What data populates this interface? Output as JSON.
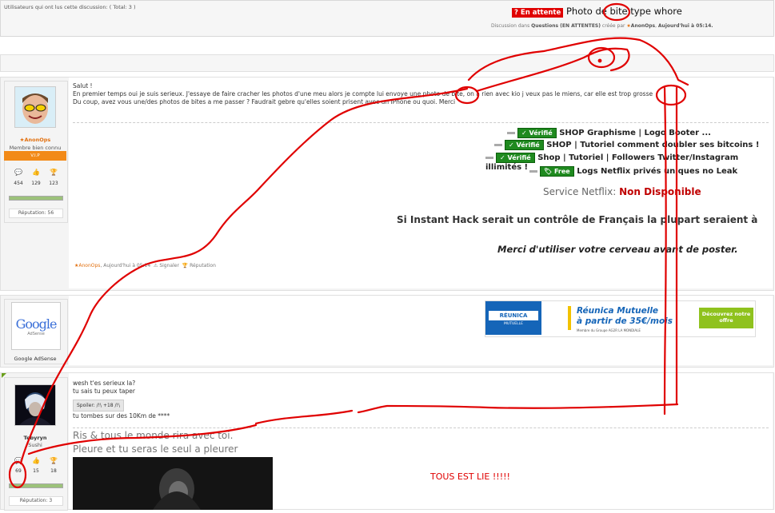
{
  "header": {
    "status_badge_icon": "?",
    "status_badge": "En attente",
    "title": "Photo de bite type whore",
    "meta_prefix": "Discussion dans",
    "meta_forum": "Questions (EN ATTENTES)",
    "meta_by": "créée par",
    "meta_author": "AnonOps",
    "meta_date": "Aujourd'hui à 05:14."
  },
  "readers": {
    "text": "Utilisateurs qui ont lus cette discussion: ( Total: 3 )"
  },
  "post1": {
    "user": {
      "name": "AnonOps",
      "title": "Membre bien connu",
      "rank": "V.I.P",
      "messages": "454",
      "likes": "129",
      "trophies": "123",
      "reputation": "Réputation: 56"
    },
    "body": [
      "Salut !",
      "En premier temps oui je suis serieux. J'essaye de faire cracher les photos d'une meu alors je compte lui envoye une photo de bite, on a rien avec kio j veux pas le miens, car elle est trop grosse",
      "Du coup, avez vous une/des photos de bites a me passer ? Faudrait gebre qu'elles soient prisent avec un iPhone ou quoi. Merci"
    ],
    "signature": {
      "lines": [
        {
          "badge": "Vérifié",
          "text": "SHOP Graphisme | Logo Booter ..."
        },
        {
          "badge": "Vérifié",
          "text": "SHOP | Tutoriel comment doubler ses bitcoins !"
        },
        {
          "badge": "Vérifié",
          "text": "Shop | Tutoriel | Followers Twitter/Instagram illimités !"
        },
        {
          "badge": "Free",
          "text": "Logs Netflix privés uniques no Leak"
        }
      ],
      "service_label": "Service Netflix:",
      "service_status": "Non Disponible",
      "quote": "Si Instant Hack serait un contrôle de Français la plupart seraient à",
      "thanks": "Merci d'utiliser votre cerveau avant de poster."
    },
    "footer": {
      "author": "AnonOps",
      "date": "Aujourd'hui à 05:14",
      "report": "Signaler",
      "reputation": "Réputation"
    }
  },
  "ad": {
    "user": "Google AdSense",
    "logo_text": "Google",
    "logo_sub": "AdSense",
    "brand": "RÉUNICA",
    "brand_sub": "MUTUELLE",
    "headline": "Réunica Mutuelle",
    "price": "à partir de 35€/mois",
    "fine_print": "Membre du Groupe AG2R LA MONDIALE",
    "cta": "Découvrez notre offre"
  },
  "post2": {
    "user": {
      "name": "Tebyryn",
      "title": "Sushi",
      "messages": "69",
      "likes": "15",
      "trophies": "18",
      "reputation": "Réputation: 3"
    },
    "body": [
      "wesh t'es serieux la?",
      "tu sais tu peux taper"
    ],
    "spoiler": "Spoiler: /!\\ +18 /!\\",
    "body2": "tu tombes sur des 10Km de ****",
    "sig1": "Ris & tous le monde rira avec toi.",
    "sig2": "Pleure et tu seras le seul a pleurer"
  },
  "annotation": {
    "text": "TOUS EST LIE !!!!!",
    "color": "#e00000"
  }
}
